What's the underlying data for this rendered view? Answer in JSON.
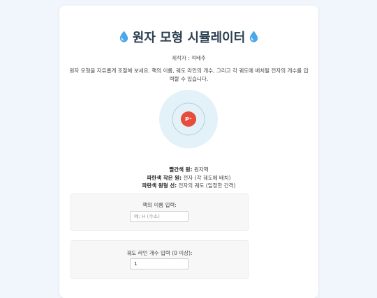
{
  "header": {
    "title": "원자 모형 시뮬레이터",
    "icon": "droplet-icon",
    "author": "제작자 : 적배추"
  },
  "description": "원자 모형을 자유롭게 조절해 보세요. 핵의 이름, 궤도 라인의 개수, 그리고 각 궤도에 배치될 전자의 개수를 입력할 수 있습니다.",
  "atom": {
    "nucleus_label": "P⁺",
    "colors": {
      "nucleus": "#e74c3c",
      "cloud": "#e3f1f8",
      "orbit": "#a9c6d6"
    }
  },
  "legend": {
    "items": [
      {
        "key": "빨간색 원:",
        "value": " 원자핵"
      },
      {
        "key": "파란색 작은 원:",
        "value": " 전자 (각 궤도에 배치)"
      },
      {
        "key": "파란색 원형 선:",
        "value": " 전자의 궤도 (일정한 간격)"
      }
    ]
  },
  "form": {
    "nucleus_name": {
      "label": "핵의 이름 입력:",
      "placeholder": "예: H (수소)",
      "value": ""
    },
    "orbit_count": {
      "label": "궤도 라인 개수 입력 (0 이상):",
      "value": "1"
    }
  }
}
